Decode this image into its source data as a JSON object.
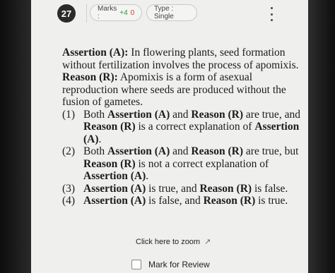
{
  "header": {
    "question_number": "27",
    "marks_label": "Marks :",
    "marks_positive": "+4",
    "marks_negative": "0",
    "type_label": "Type : Single"
  },
  "question": {
    "assertion_label": "Assertion (A):",
    "assertion_text": "In flowering plants, seed formation without fertilization involves the process of apomixis.",
    "reason_label": "Reason (R):",
    "reason_text": "Apomixis is a form of asexual reproduction where seeds are produced without the fusion of gametes.",
    "options": [
      {
        "num": "(1)",
        "p1": "Both ",
        "b1": "Assertion (A)",
        "p2": " and ",
        "b2": "Reason (R)",
        "p3": " are true, and ",
        "b3": "Reason (R)",
        "p4": " is a correct explanation of ",
        "b4": "Assertion (A)",
        "p5": "."
      },
      {
        "num": "(2)",
        "p1": "Both ",
        "b1": "Assertion (A)",
        "p2": " and ",
        "b2": "Reason (R)",
        "p3": " are true, but ",
        "b3": "Reason (R)",
        "p4": " is not a correct explanation of ",
        "b4": "Assertion (A)",
        "p5": "."
      },
      {
        "num": "(3)",
        "b1": "Assertion (A)",
        "p1": " is true, and ",
        "b2": "Reason (R)",
        "p2": " is false."
      },
      {
        "num": "(4)",
        "b1": "Assertion (A)",
        "p1": " is false, and ",
        "b2": "Reason (R)",
        "p2": " is true."
      }
    ]
  },
  "footer": {
    "zoom_label": "Click here to zoom",
    "review_label": "Mark for Review"
  },
  "icons": {
    "menu": "more-vertical-icon",
    "zoom": "expand-icon"
  }
}
